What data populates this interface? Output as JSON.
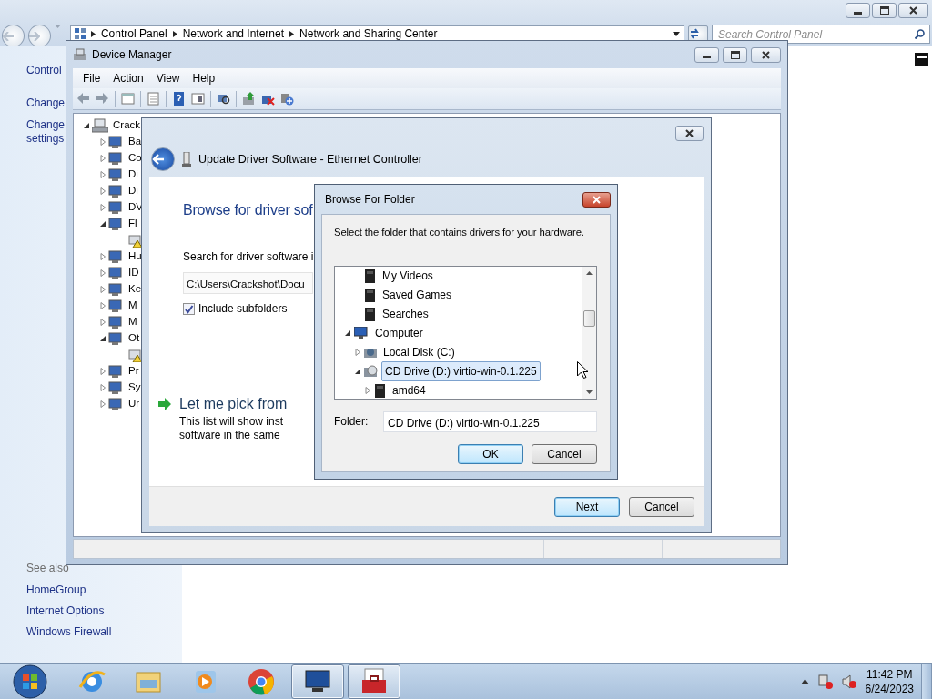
{
  "explorer": {
    "breadcrumb": [
      "Control Panel",
      "Network and Internet",
      "Network and Sharing Center"
    ],
    "search": {
      "placeholder": "Search Control Panel"
    },
    "sidebar": {
      "items": [
        "Control",
        "Change",
        "Change settings"
      ],
      "see_also_title": "See also",
      "see_also": [
        "HomeGroup",
        "Internet Options",
        "Windows Firewall"
      ]
    }
  },
  "device_manager": {
    "title": "Device Manager",
    "menu": [
      "File",
      "Action",
      "View",
      "Help"
    ],
    "tree": {
      "label": "Crack",
      "expanded": true,
      "children": [
        {
          "label": "Ba",
          "expanded": false
        },
        {
          "label": "Co",
          "expanded": false
        },
        {
          "label": "Di",
          "expanded": false
        },
        {
          "label": "Di",
          "expanded": false
        },
        {
          "label": "DV",
          "expanded": false
        },
        {
          "label": "Fl",
          "expanded": true,
          "children": [
            {
              "kind": "warning"
            }
          ]
        },
        {
          "label": "Hu",
          "expanded": false
        },
        {
          "label": "ID",
          "expanded": false
        },
        {
          "label": "Ke",
          "expanded": false
        },
        {
          "label": "M",
          "expanded": false
        },
        {
          "label": "M",
          "expanded": false
        },
        {
          "label": "Ot",
          "expanded": true,
          "children": [
            {
              "kind": "warning"
            }
          ]
        },
        {
          "label": "Pr",
          "expanded": false
        },
        {
          "label": "Sy",
          "expanded": false
        },
        {
          "label": "Ur",
          "expanded": false
        }
      ]
    }
  },
  "update_driver": {
    "title": "Update Driver Software - Ethernet Controller",
    "heading": "Browse for driver sof",
    "search_label": "Search for driver software i",
    "path": {
      "value": "C:\\Users\\Crackshot\\Docu"
    },
    "include_subfolders": {
      "label": "Include subfolders",
      "checked": true
    },
    "pick": {
      "title": "Let me pick from",
      "description": [
        "This list will show inst",
        "software in the same"
      ]
    },
    "buttons": [
      {
        "label": "Next",
        "default": true
      },
      {
        "label": "Cancel",
        "default": false
      }
    ]
  },
  "browse_folder": {
    "title": "Browse For Folder",
    "prompt": "Select the folder that contains drivers for your hardware.",
    "tree": [
      {
        "label": "My Videos",
        "selected": false
      },
      {
        "label": "Saved Games",
        "selected": false
      },
      {
        "label": "Searches",
        "selected": false
      },
      {
        "label": "Computer",
        "kind": "computer",
        "expanded": true,
        "selected": false,
        "children": [
          {
            "label": "Local Disk (C:)",
            "kind": "disk",
            "expanded": false,
            "selected": false
          },
          {
            "label": "CD Drive (D:) virtio-win-0.1.225",
            "kind": "cd",
            "expanded": true,
            "selected": true,
            "children": [
              {
                "label": "amd64",
                "expanded": false,
                "selected": false
              }
            ]
          }
        ]
      }
    ],
    "folder": {
      "label": "Folder:",
      "value": "CD Drive (D:) virtio-win-0.1.225"
    },
    "buttons": [
      {
        "label": "OK",
        "default": true
      },
      {
        "label": "Cancel",
        "default": false
      }
    ]
  },
  "taskbar": {
    "apps": [
      {
        "kind": "browser",
        "active": false
      },
      {
        "kind": "folder",
        "active": false
      },
      {
        "kind": "media",
        "active": false
      },
      {
        "kind": "chrome",
        "active": false
      },
      {
        "kind": "monitor",
        "active": true
      },
      {
        "kind": "toolbox",
        "active": true
      }
    ],
    "clock": {
      "time": "11:42 PM",
      "date": "6/24/2023"
    }
  }
}
